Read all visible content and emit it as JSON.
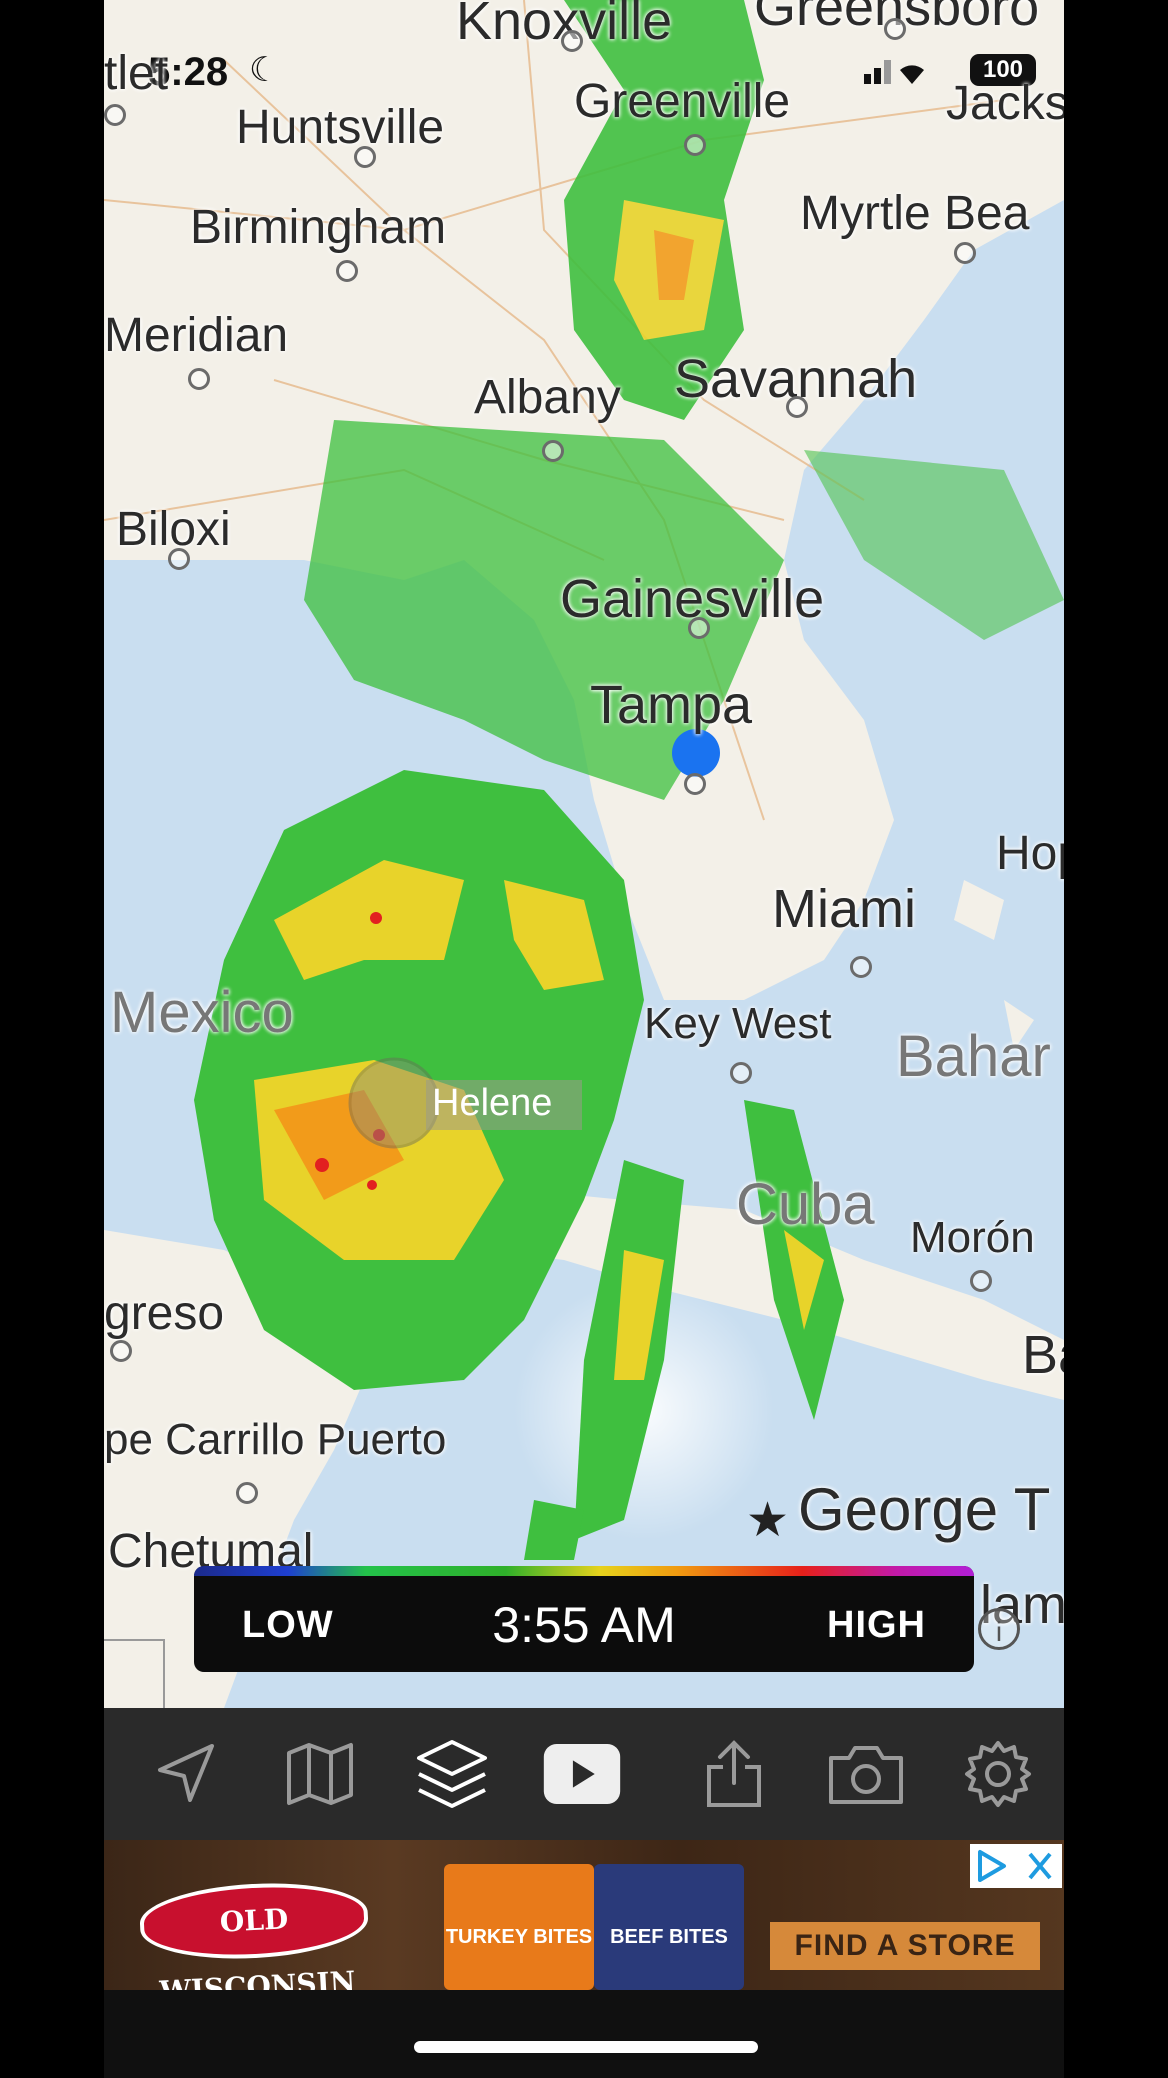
{
  "status_bar": {
    "time": "5:28",
    "battery": "100"
  },
  "map": {
    "cities": [
      {
        "name": "Knoxville"
      },
      {
        "name": "Greensboro"
      },
      {
        "name": "tlet"
      },
      {
        "name": "Greenville"
      },
      {
        "name": "Jacks"
      },
      {
        "name": "Huntsville"
      },
      {
        "name": "Birmingham"
      },
      {
        "name": "Myrtle Bea"
      },
      {
        "name": "Meridian"
      },
      {
        "name": "Albany"
      },
      {
        "name": "Savannah"
      },
      {
        "name": "Biloxi"
      },
      {
        "name": "Gainesville"
      },
      {
        "name": "Tampa"
      },
      {
        "name": "Hop"
      },
      {
        "name": "Miami"
      },
      {
        "name": "Mexico"
      },
      {
        "name": "Key West"
      },
      {
        "name": "Bahar"
      },
      {
        "name": "Helene"
      },
      {
        "name": "Cuba"
      },
      {
        "name": "Morón"
      },
      {
        "name": "greso"
      },
      {
        "name": "Ba"
      },
      {
        "name": "pe Carrillo Puerto"
      },
      {
        "name": "George T"
      },
      {
        "name": "Chetumal"
      },
      {
        "name": "lam"
      }
    ]
  },
  "legend": {
    "low": "LOW",
    "time": "3:55 AM",
    "high": "HIGH"
  },
  "toolbar": {
    "items": [
      {
        "icon": "location-arrow-icon"
      },
      {
        "icon": "map-icon"
      },
      {
        "icon": "layers-icon"
      },
      {
        "icon": "play-icon"
      },
      {
        "icon": "share-icon"
      },
      {
        "icon": "camera-icon"
      },
      {
        "icon": "settings-icon"
      }
    ]
  },
  "ad": {
    "brand": "OLD WISCONSIN",
    "product1": "TURKEY BITES",
    "product2": "BEEF BITES",
    "cta": "FIND A STORE"
  }
}
